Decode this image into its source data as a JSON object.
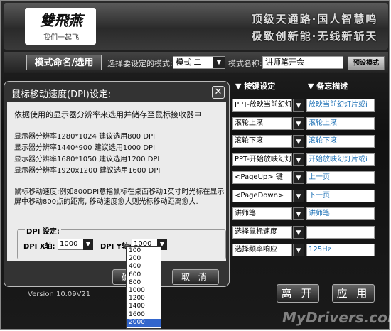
{
  "header": {
    "logo_text": "雙飛燕",
    "logo_subtitle": "我们一起飞",
    "slogan_line1": "顶级天通路·国人智慧鸣",
    "slogan_line2": "极致创新能·无线新斩天"
  },
  "toolbar": {
    "tab_label": "模式命名/选用",
    "select_mode_label": "选择要设定的模式:",
    "mode_value": "模式 二",
    "mode_name_label": "模式名称:",
    "mode_name_value": "讲师笔开会",
    "preset_label": "预设模式"
  },
  "key_panel": {
    "header_key": "▼ 按键设定",
    "header_desc": "▼ 备忘描述",
    "rows": [
      {
        "key": "PPT-放映当前幻灯",
        "desc": "放映当前幻灯片或i"
      },
      {
        "key": "滚轮上滚",
        "desc": "滚轮上滚"
      },
      {
        "key": "滚轮下滚",
        "desc": "滚轮下滚"
      },
      {
        "key": "PPT-开始放映幻灯",
        "desc": "开始放映幻灯片或i"
      },
      {
        "key": "<PageUp> 键",
        "desc": "上一页"
      },
      {
        "key": "<PageDown>",
        "desc": "下一页"
      },
      {
        "key": "讲师笔",
        "desc": "讲师笔"
      },
      {
        "key": "选择鼠标速度",
        "desc": ""
      },
      {
        "key": "选择频率响应",
        "desc": "125Hz"
      }
    ]
  },
  "dialog": {
    "title": "鼠标移动速度(DPI)设定:",
    "intro": "依据使用的显示器分辨率来选用并储存至鼠标接收器中",
    "rec1": "显示器分辨率1280*1024 建议选用800  DPI",
    "rec2": "显示器分辨率1440*900  建议选用1000 DPI",
    "rec3": "显示器分辨率1680*1050 建议选用1200 DPI",
    "rec4": "显示器分辨率1920x1200 建议选用1600 DPI",
    "note1": "鼠标移动速度:例如800DPI意指鼠标在桌面移动1英寸时光标在显示",
    "note2": "屏中移动800点的距离, 移动速度愈大则光标移动距离愈大.",
    "dpi_group": "DPI 设定:",
    "dpi_x_label": "DPI X轴:",
    "dpi_x_value": "1000",
    "dpi_y_label": "DPI Y轴:",
    "dpi_y_value": "1000",
    "ok_label": "确 定",
    "cancel_label": "取 消",
    "dropdown_options": [
      "100",
      "200",
      "400",
      "600",
      "800",
      "1000",
      "1200",
      "1400",
      "1600",
      "2000"
    ],
    "dropdown_selected": "2000"
  },
  "footer": {
    "version": "Version 10.09V21",
    "exit_label": "离 开",
    "apply_label": "应 用",
    "watermark": "MyDrivers.com"
  }
}
